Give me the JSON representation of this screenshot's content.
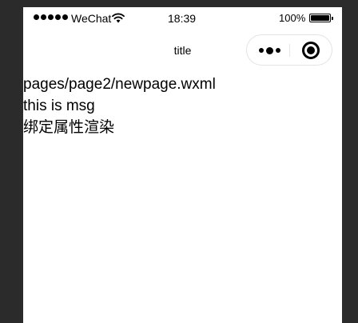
{
  "status_bar": {
    "carrier": "WeChat",
    "time": "18:39",
    "battery_percent": "100%",
    "battery_level": 1.0,
    "signal_icon": "signal-dots-icon",
    "wifi_icon": "wifi-icon",
    "battery_icon": "battery-icon"
  },
  "nav": {
    "title": "title",
    "menu_icon": "more-dots-icon",
    "close_icon": "target-close-icon"
  },
  "content": {
    "lines": [
      "pages/page2/newpage.wxml",
      "this is msg",
      "绑定属性渲染"
    ]
  },
  "colors": {
    "backdrop": "#2b2b2b",
    "page": "#ffffff",
    "text": "#000000",
    "capsule_border": "#e3e3e3"
  }
}
